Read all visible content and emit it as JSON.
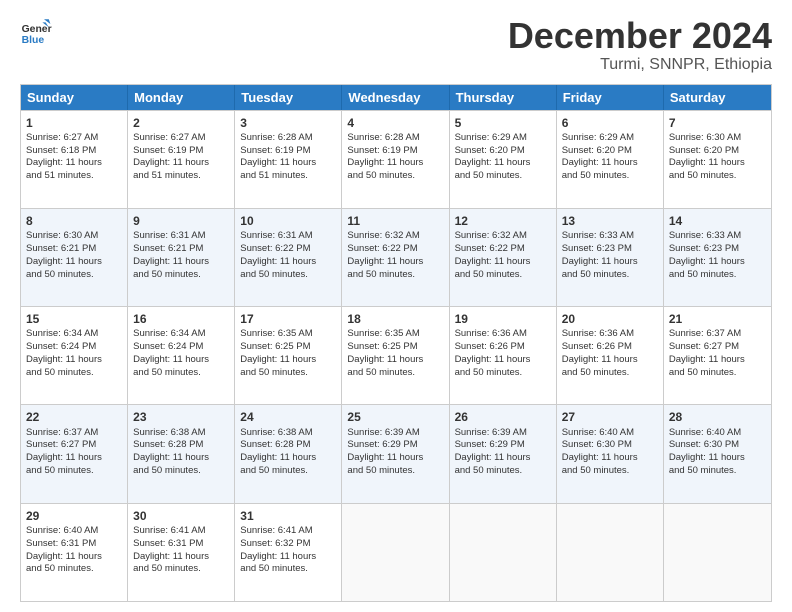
{
  "logo": {
    "line1": "General",
    "line2": "Blue"
  },
  "title": "December 2024",
  "subtitle": "Turmi, SNNPR, Ethiopia",
  "header_days": [
    "Sunday",
    "Monday",
    "Tuesday",
    "Wednesday",
    "Thursday",
    "Friday",
    "Saturday"
  ],
  "weeks": [
    [
      {
        "day": 1,
        "info": "Sunrise: 6:27 AM\nSunset: 6:18 PM\nDaylight: 11 hours\nand 51 minutes."
      },
      {
        "day": 2,
        "info": "Sunrise: 6:27 AM\nSunset: 6:19 PM\nDaylight: 11 hours\nand 51 minutes."
      },
      {
        "day": 3,
        "info": "Sunrise: 6:28 AM\nSunset: 6:19 PM\nDaylight: 11 hours\nand 51 minutes."
      },
      {
        "day": 4,
        "info": "Sunrise: 6:28 AM\nSunset: 6:19 PM\nDaylight: 11 hours\nand 50 minutes."
      },
      {
        "day": 5,
        "info": "Sunrise: 6:29 AM\nSunset: 6:20 PM\nDaylight: 11 hours\nand 50 minutes."
      },
      {
        "day": 6,
        "info": "Sunrise: 6:29 AM\nSunset: 6:20 PM\nDaylight: 11 hours\nand 50 minutes."
      },
      {
        "day": 7,
        "info": "Sunrise: 6:30 AM\nSunset: 6:20 PM\nDaylight: 11 hours\nand 50 minutes."
      }
    ],
    [
      {
        "day": 8,
        "info": "Sunrise: 6:30 AM\nSunset: 6:21 PM\nDaylight: 11 hours\nand 50 minutes."
      },
      {
        "day": 9,
        "info": "Sunrise: 6:31 AM\nSunset: 6:21 PM\nDaylight: 11 hours\nand 50 minutes."
      },
      {
        "day": 10,
        "info": "Sunrise: 6:31 AM\nSunset: 6:22 PM\nDaylight: 11 hours\nand 50 minutes."
      },
      {
        "day": 11,
        "info": "Sunrise: 6:32 AM\nSunset: 6:22 PM\nDaylight: 11 hours\nand 50 minutes."
      },
      {
        "day": 12,
        "info": "Sunrise: 6:32 AM\nSunset: 6:22 PM\nDaylight: 11 hours\nand 50 minutes."
      },
      {
        "day": 13,
        "info": "Sunrise: 6:33 AM\nSunset: 6:23 PM\nDaylight: 11 hours\nand 50 minutes."
      },
      {
        "day": 14,
        "info": "Sunrise: 6:33 AM\nSunset: 6:23 PM\nDaylight: 11 hours\nand 50 minutes."
      }
    ],
    [
      {
        "day": 15,
        "info": "Sunrise: 6:34 AM\nSunset: 6:24 PM\nDaylight: 11 hours\nand 50 minutes."
      },
      {
        "day": 16,
        "info": "Sunrise: 6:34 AM\nSunset: 6:24 PM\nDaylight: 11 hours\nand 50 minutes."
      },
      {
        "day": 17,
        "info": "Sunrise: 6:35 AM\nSunset: 6:25 PM\nDaylight: 11 hours\nand 50 minutes."
      },
      {
        "day": 18,
        "info": "Sunrise: 6:35 AM\nSunset: 6:25 PM\nDaylight: 11 hours\nand 50 minutes."
      },
      {
        "day": 19,
        "info": "Sunrise: 6:36 AM\nSunset: 6:26 PM\nDaylight: 11 hours\nand 50 minutes."
      },
      {
        "day": 20,
        "info": "Sunrise: 6:36 AM\nSunset: 6:26 PM\nDaylight: 11 hours\nand 50 minutes."
      },
      {
        "day": 21,
        "info": "Sunrise: 6:37 AM\nSunset: 6:27 PM\nDaylight: 11 hours\nand 50 minutes."
      }
    ],
    [
      {
        "day": 22,
        "info": "Sunrise: 6:37 AM\nSunset: 6:27 PM\nDaylight: 11 hours\nand 50 minutes."
      },
      {
        "day": 23,
        "info": "Sunrise: 6:38 AM\nSunset: 6:28 PM\nDaylight: 11 hours\nand 50 minutes."
      },
      {
        "day": 24,
        "info": "Sunrise: 6:38 AM\nSunset: 6:28 PM\nDaylight: 11 hours\nand 50 minutes."
      },
      {
        "day": 25,
        "info": "Sunrise: 6:39 AM\nSunset: 6:29 PM\nDaylight: 11 hours\nand 50 minutes."
      },
      {
        "day": 26,
        "info": "Sunrise: 6:39 AM\nSunset: 6:29 PM\nDaylight: 11 hours\nand 50 minutes."
      },
      {
        "day": 27,
        "info": "Sunrise: 6:40 AM\nSunset: 6:30 PM\nDaylight: 11 hours\nand 50 minutes."
      },
      {
        "day": 28,
        "info": "Sunrise: 6:40 AM\nSunset: 6:30 PM\nDaylight: 11 hours\nand 50 minutes."
      }
    ],
    [
      {
        "day": 29,
        "info": "Sunrise: 6:40 AM\nSunset: 6:31 PM\nDaylight: 11 hours\nand 50 minutes."
      },
      {
        "day": 30,
        "info": "Sunrise: 6:41 AM\nSunset: 6:31 PM\nDaylight: 11 hours\nand 50 minutes."
      },
      {
        "day": 31,
        "info": "Sunrise: 6:41 AM\nSunset: 6:32 PM\nDaylight: 11 hours\nand 50 minutes."
      },
      {
        "day": null
      },
      {
        "day": null
      },
      {
        "day": null
      },
      {
        "day": null
      }
    ]
  ]
}
